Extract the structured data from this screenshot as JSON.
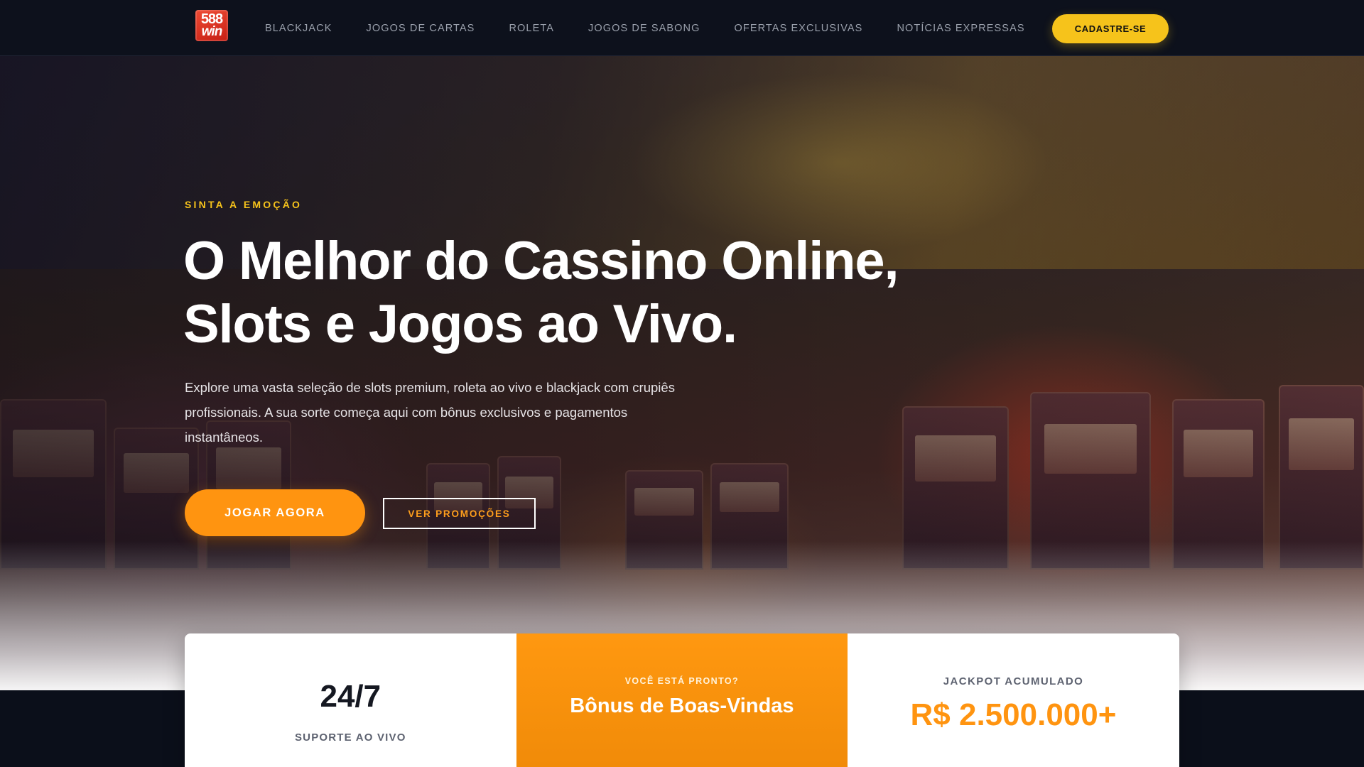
{
  "brand": {
    "logo_line1": "588",
    "logo_line2": "win"
  },
  "nav": {
    "items": [
      {
        "label": "BLACKJACK"
      },
      {
        "label": "JOGOS DE CARTAS"
      },
      {
        "label": "ROLETA"
      },
      {
        "label": "JOGOS DE SABONG"
      },
      {
        "label": "OFERTAS EXCLUSIVAS"
      },
      {
        "label": "NOTÍCIAS EXPRESSAS"
      }
    ],
    "signup_label": "CADASTRE-SE"
  },
  "hero": {
    "kicker": "SINTA A EMOÇÃO",
    "headline_line1": "O Melhor do Cassino Online,",
    "headline_line2": "Slots e Jogos ao Vivo.",
    "lead": "Explore uma vasta seleção de slots premium, roleta ao vivo e blackjack com crupiês profissionais. A sua sorte começa aqui com bônus exclusivos e pagamentos instantâneos.",
    "play_label": "JOGAR AGORA",
    "promo_label": "VER PROMOÇÕES"
  },
  "stats": {
    "support_value": "24/7",
    "support_label": "SUPORTE AO VIVO",
    "bonus_kicker": "VOCÊ ESTÁ PRONTO?",
    "bonus_title": "Bônus de Boas-Vindas",
    "jackpot_label": "JACKPOT ACUMULADO",
    "jackpot_value": "R$ 2.500.000+"
  },
  "colors": {
    "accent_yellow": "#f6c31b",
    "accent_orange": "#ff9410",
    "nav_bg": "#0d111c"
  }
}
